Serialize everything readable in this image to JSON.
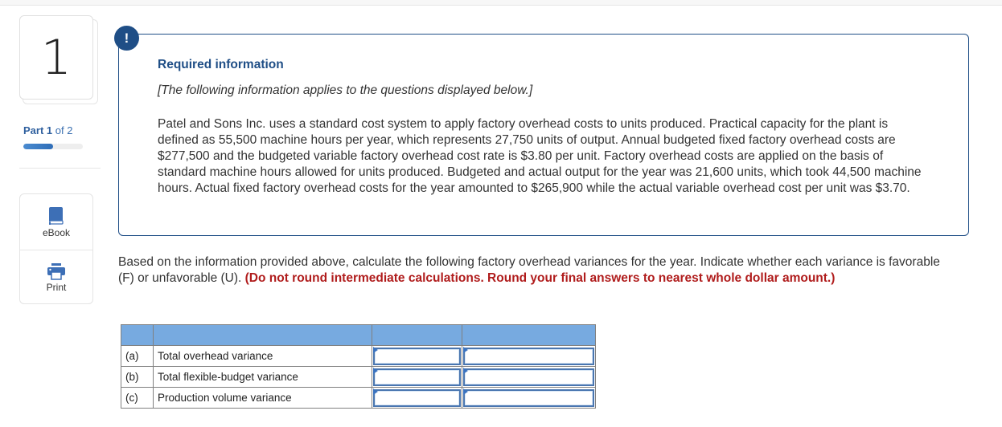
{
  "question": {
    "number": "1",
    "part_label": "Part",
    "part_current": "1",
    "part_of": "of 2",
    "part_progress": 0.5
  },
  "tools": [
    {
      "label": "eBook",
      "icon": "book-icon"
    },
    {
      "label": "Print",
      "icon": "printer-icon"
    }
  ],
  "info": {
    "alert_icon": "!",
    "title": "Required information",
    "subtitle": "[The following information applies to the questions displayed below.]",
    "body": "Patel and Sons Inc. uses a standard cost system to apply factory overhead costs to units produced. Practical capacity for the plant is defined as 55,500 machine hours per year, which represents 27,750 units of output. Annual budgeted fixed factory overhead costs are $277,500 and the budgeted variable factory overhead cost rate is $3.80 per unit. Factory overhead costs are applied on the basis of standard machine hours allowed for units produced. Budgeted and actual output for the year was 21,600 units, which took 44,500 machine hours. Actual fixed factory overhead costs for the year amounted to $265,900 while the actual variable overhead cost per unit was $3.70."
  },
  "instructions": {
    "text": "Based on the information provided above, calculate the following factory overhead variances for the year. Indicate whether each variance is favorable (F) or unfavorable (U). ",
    "emphasis": "(Do not round intermediate calculations. Round your final answers to nearest whole dollar amount.)"
  },
  "table": {
    "headers": [
      "",
      "",
      "",
      ""
    ],
    "rows": [
      {
        "letter": "(a)",
        "label": "Total overhead variance",
        "amount": "",
        "type": ""
      },
      {
        "letter": "(b)",
        "label": "Total flexible-budget variance",
        "amount": "",
        "type": ""
      },
      {
        "letter": "(c)",
        "label": "Production volume variance",
        "amount": "",
        "type": ""
      }
    ]
  },
  "colors": {
    "brand_navy": "#1f4e86",
    "emphasis_red": "#b01c1c",
    "table_header": "#77aae0",
    "progress": "#3a7bc8"
  }
}
